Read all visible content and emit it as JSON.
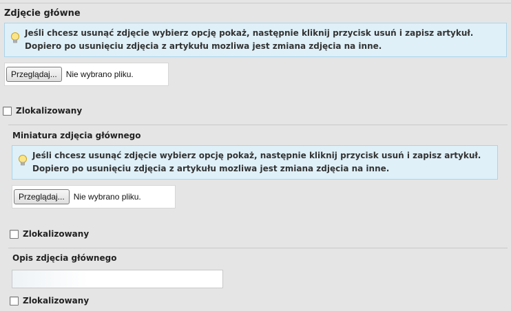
{
  "main_image": {
    "title": "Zdjęcie główne",
    "info_text": "Jeśli chcesz usunąć zdjęcie wybierz opcję pokaż, następnie kliknij przycisk usuń i zapisz artykuł. Dopiero po usunięciu zdjęcia z artykułu mozliwa jest zmiana zdjęcia na inne.",
    "browse_label": "Przeglądaj...",
    "file_status": "Nie wybrano pliku.",
    "localized_label": "Zlokalizowany"
  },
  "thumbnail": {
    "title": "Miniatura zdjęcia głównego",
    "info_text": "Jeśli chcesz usunąć zdjęcie wybierz opcję pokaż, następnie kliknij przycisk usuń i zapisz artykuł. Dopiero po usunięciu zdjęcia z artykułu mozliwa jest zmiana zdjęcia na inne.",
    "browse_label": "Przeglądaj...",
    "file_status": "Nie wybrano pliku.",
    "localized_label": "Zlokalizowany"
  },
  "description": {
    "title": "Opis zdjęcia głównego",
    "value": "",
    "localized_label": "Zlokalizowany"
  },
  "icons": {
    "info": "lightbulb-icon"
  },
  "colors": {
    "info_bg": "#dff0f8",
    "info_border": "#a9d4ea",
    "page_bg": "#e5e5e5"
  }
}
